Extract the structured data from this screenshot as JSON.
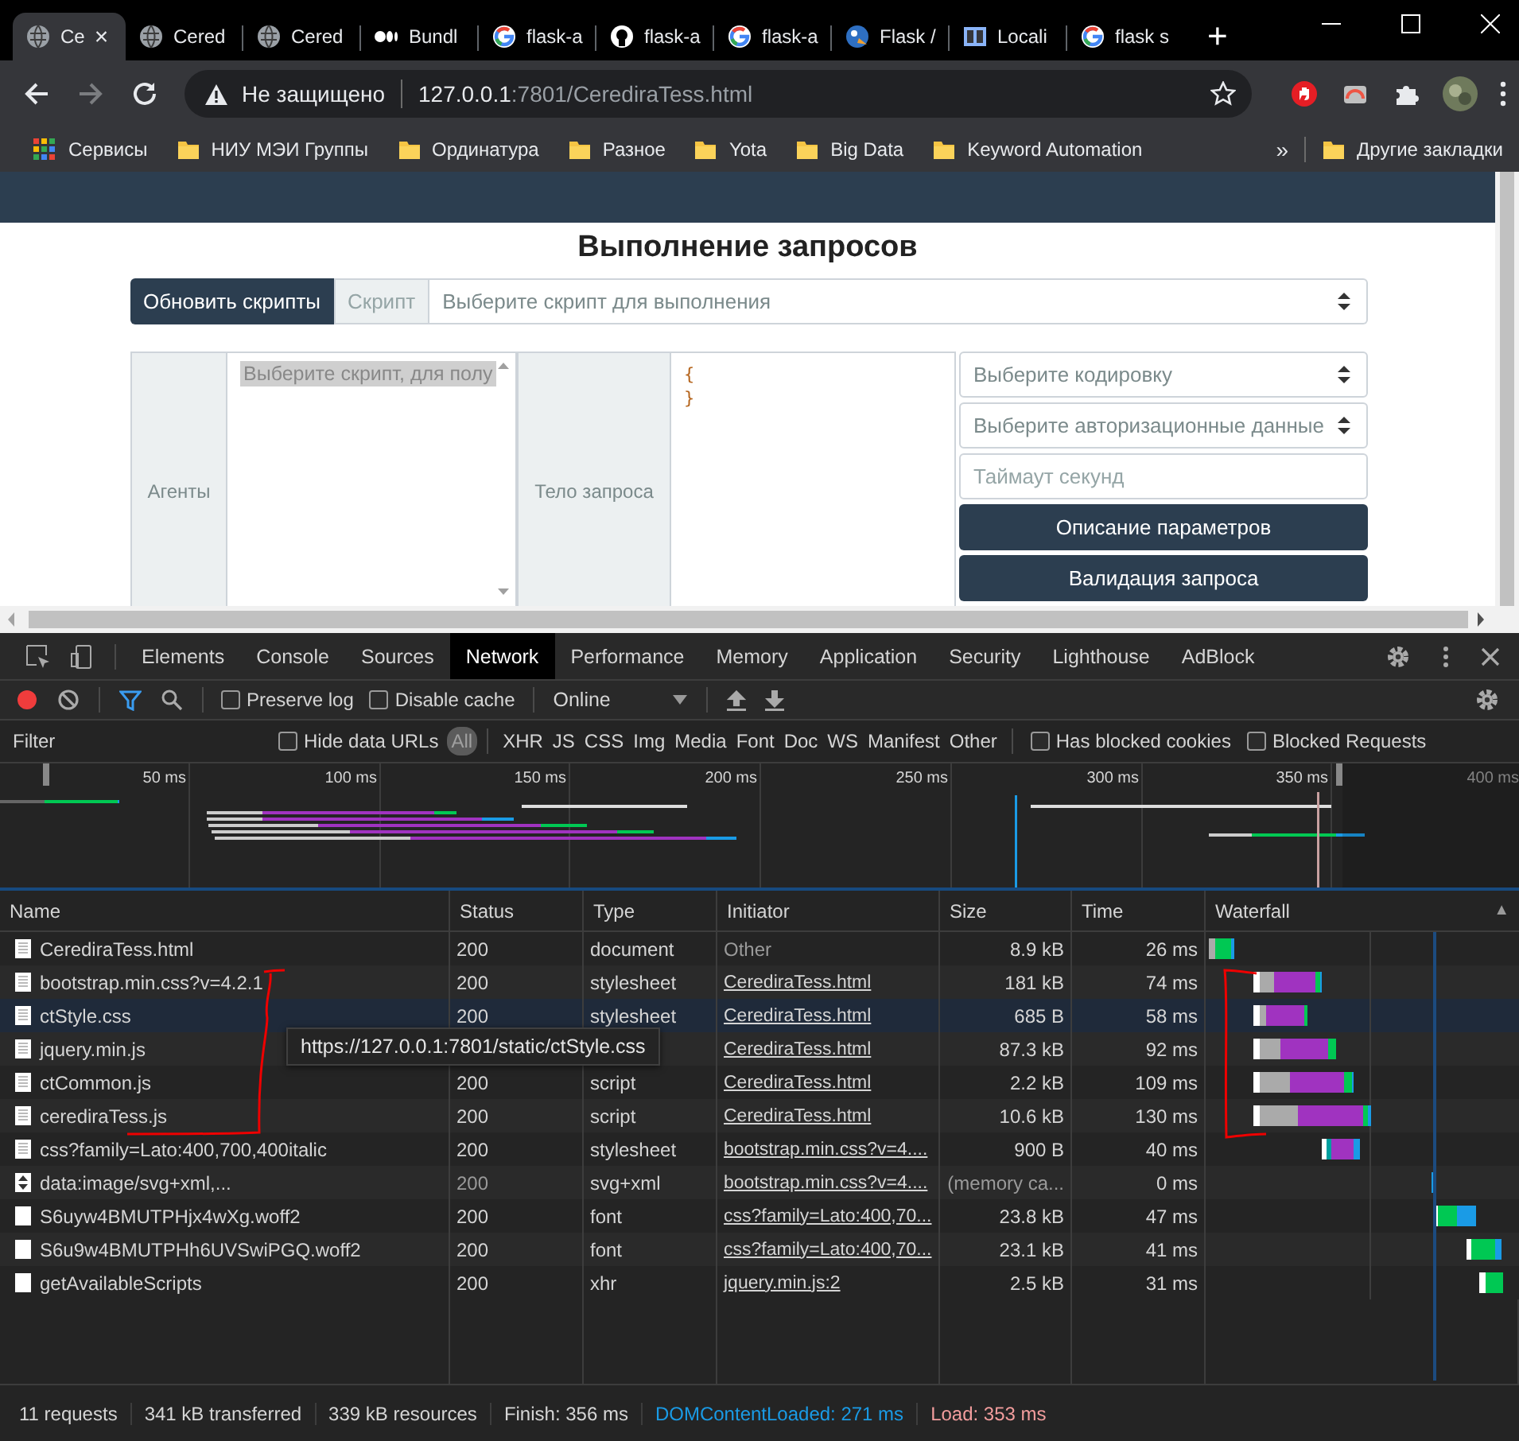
{
  "browser": {
    "tabs": [
      {
        "title": "Ce",
        "selected": true,
        "kind": "globe"
      },
      {
        "title": "Cered",
        "selected": false,
        "kind": "globe"
      },
      {
        "title": "Cered",
        "selected": false,
        "kind": "globe"
      },
      {
        "title": "Bundl",
        "selected": false,
        "kind": "dots"
      },
      {
        "title": "flask-a",
        "selected": false,
        "kind": "google"
      },
      {
        "title": "flask-a",
        "selected": false,
        "kind": "github"
      },
      {
        "title": "flask-a",
        "selected": false,
        "kind": "google"
      },
      {
        "title": "Flask /",
        "selected": false,
        "kind": "bird"
      },
      {
        "title": "Locali",
        "selected": false,
        "kind": "book"
      },
      {
        "title": "flask s",
        "selected": false,
        "kind": "google"
      }
    ],
    "tab_close": "×",
    "new_tab": "+",
    "address": {
      "security": "Не защищено",
      "host": "127.0.0.1",
      "path": ":7801/CerediraTess.html"
    },
    "bookmarks": [
      "Сервисы",
      "НИУ МЭИ Группы",
      "Ординатура",
      "Разное",
      "Yota",
      "Big Data",
      "Keyword Automation"
    ],
    "bookmarks_more": "»",
    "other_bookmarks": "Другие закладки"
  },
  "page": {
    "title": "Выполнение запросов",
    "refresh_button": "Обновить скрипты",
    "script_label": "Скрипт",
    "script_select": "Выберите скрипт для выполнения",
    "agents_label": "Агенты",
    "agents_option": "Выберите скрипт, для полу",
    "body_label": "Тело запроса",
    "body_field": {
      "value": "{\n}"
    },
    "encoding_select": "Выберите кодировку",
    "auth_select": "Выберите авторизационные данные",
    "timeout_field": {
      "placeholder": "Таймаут секунд"
    },
    "buttons": [
      "Описание параметров",
      "Валидация запроса"
    ]
  },
  "devtools": {
    "panel_tabs": [
      {
        "label": "Elements",
        "selected": false
      },
      {
        "label": "Console",
        "selected": false
      },
      {
        "label": "Sources",
        "selected": false
      },
      {
        "label": "Network",
        "selected": true
      },
      {
        "label": "Performance",
        "selected": false
      },
      {
        "label": "Memory",
        "selected": false
      },
      {
        "label": "Application",
        "selected": false
      },
      {
        "label": "Security",
        "selected": false
      },
      {
        "label": "Lighthouse",
        "selected": false
      },
      {
        "label": "AdBlock",
        "selected": false
      }
    ],
    "toolbar": {
      "recording": true,
      "preserve_log": {
        "label": "Preserve log",
        "checked": false
      },
      "disable_cache": {
        "label": "Disable cache",
        "checked": false
      },
      "throttling": "Online"
    },
    "filter": {
      "placeholder": "Filter",
      "hide_data_urls": {
        "label": "Hide data URLs",
        "checked": false
      },
      "types": [
        {
          "label": "All",
          "selected": true
        },
        {
          "label": "XHR",
          "selected": false
        },
        {
          "label": "JS",
          "selected": false
        },
        {
          "label": "CSS",
          "selected": false
        },
        {
          "label": "Img",
          "selected": false
        },
        {
          "label": "Media",
          "selected": false
        },
        {
          "label": "Font",
          "selected": false
        },
        {
          "label": "Doc",
          "selected": false
        },
        {
          "label": "WS",
          "selected": false
        },
        {
          "label": "Manifest",
          "selected": false
        },
        {
          "label": "Other",
          "selected": false
        }
      ],
      "has_blocked_cookies": {
        "label": "Has blocked cookies",
        "checked": false
      },
      "blocked_requests": {
        "label": "Blocked Requests",
        "checked": false
      }
    },
    "overview_ticks": [
      "50 ms",
      "100 ms",
      "150 ms",
      "200 ms",
      "250 ms",
      "300 ms",
      "350 ms",
      "400 ms"
    ],
    "table": {
      "columns": [
        "Name",
        "Status",
        "Type",
        "Initiator",
        "Size",
        "Time",
        "Waterfall"
      ],
      "sort_indicator": "▲",
      "rows": [
        {
          "name": "CerediraTess.html",
          "kind": "document",
          "status": "200",
          "type": "document",
          "initiator": "Other",
          "initiator_link": false,
          "size": "8.9 kB",
          "time": "26 ms",
          "cached": false,
          "selected": false
        },
        {
          "name": "bootstrap.min.css?v=4.2.1",
          "kind": "document",
          "status": "200",
          "type": "stylesheet",
          "initiator": "CerediraTess.html",
          "initiator_link": true,
          "size": "181 kB",
          "time": "74 ms",
          "cached": false,
          "selected": false
        },
        {
          "name": "ctStyle.css",
          "kind": "document",
          "status": "200",
          "type": "stylesheet",
          "initiator": "CerediraTess.html",
          "initiator_link": true,
          "size": "685 B",
          "time": "58 ms",
          "cached": false,
          "selected": true
        },
        {
          "name": "jquery.min.js",
          "kind": "document",
          "initiator": "CerediraTess.html",
          "initiator_link": true,
          "size": "87.3 kB",
          "time": "92 ms",
          "cached": false,
          "selected": false
        },
        {
          "name": "ctCommon.js",
          "kind": "document",
          "status": "200",
          "type": "script",
          "initiator": "CerediraTess.html",
          "initiator_link": true,
          "size": "2.2 kB",
          "time": "109 ms",
          "cached": false,
          "selected": false
        },
        {
          "name": "cerediraTess.js",
          "kind": "document",
          "status": "200",
          "type": "script",
          "initiator": "CerediraTess.html",
          "initiator_link": true,
          "size": "10.6 kB",
          "time": "130 ms",
          "cached": false,
          "selected": false
        },
        {
          "name": "css?family=Lato:400,700,400italic",
          "kind": "document",
          "status": "200",
          "type": "stylesheet",
          "initiator": "bootstrap.min.css?v=4....",
          "initiator_link": true,
          "size": "900 B",
          "time": "40 ms",
          "cached": false,
          "selected": false
        },
        {
          "name": "data:image/svg+xml,...",
          "kind": "image",
          "status": "200",
          "type": "svg+xml",
          "initiator": "bootstrap.min.css?v=4....",
          "initiator_link": true,
          "size": "(memory ca...",
          "time": "0 ms",
          "cached": true,
          "selected": false
        },
        {
          "name": "S6uyw4BMUTPHjx4wXg.woff2",
          "kind": "blank",
          "status": "200",
          "type": "font",
          "initiator": "css?family=Lato:400,70...",
          "initiator_link": true,
          "size": "23.8 kB",
          "time": "47 ms",
          "cached": false,
          "selected": false
        },
        {
          "name": "S6u9w4BMUTPHh6UVSwiPGQ.woff2",
          "kind": "blank",
          "status": "200",
          "type": "font",
          "initiator": "css?family=Lato:400,70...",
          "initiator_link": true,
          "size": "23.1 kB",
          "time": "41 ms",
          "cached": false,
          "selected": false
        },
        {
          "name": "getAvailableScripts",
          "kind": "blank",
          "status": "200",
          "type": "xhr",
          "initiator": "jquery.min.js:2",
          "initiator_link": true,
          "size": "2.5 kB",
          "time": "31 ms",
          "cached": false,
          "selected": false
        }
      ]
    },
    "tooltip": "https://127.0.0.1:7801/static/ctStyle.css",
    "status_bar": [
      {
        "text": "11 requests",
        "color": "#d5d5d5"
      },
      {
        "text": "341 kB transferred",
        "color": "#d5d5d5"
      },
      {
        "text": "339 kB resources",
        "color": "#d5d5d5"
      },
      {
        "text": "Finish: 356 ms",
        "color": "#d5d5d5"
      },
      {
        "text": "DOMContentLoaded: 271 ms",
        "color": "#1a9be6"
      },
      {
        "text": "Load: 353 ms",
        "color": "#f29d9d"
      }
    ]
  }
}
